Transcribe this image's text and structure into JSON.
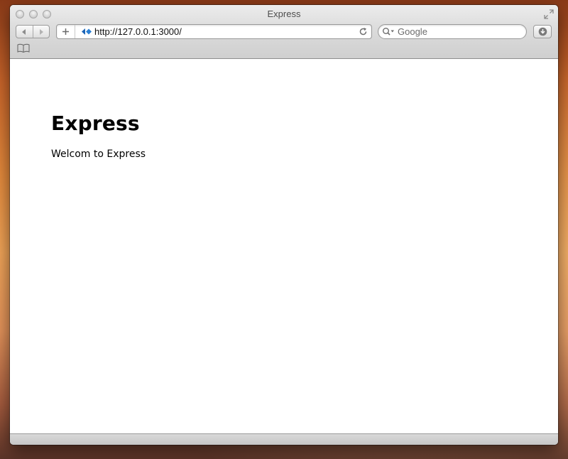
{
  "window": {
    "title": "Express"
  },
  "toolbar": {
    "back_icon": "back-arrow-icon",
    "forward_icon": "forward-arrow-icon",
    "add_bookmark_icon": "plus-icon",
    "address": {
      "url": "http://127.0.0.1:3000/",
      "favicon": "express-favicon-icon",
      "reload_icon": "reload-icon"
    },
    "search": {
      "placeholder": "Google",
      "icon": "search-icon"
    },
    "downloads_icon": "downloads-icon"
  },
  "bookmarks_bar": {
    "icon": "book-icon"
  },
  "page": {
    "heading": "Express",
    "text": "Welcom to Express"
  },
  "colors": {
    "accent": "#1a63b5",
    "desktop": "#e48a3c"
  }
}
